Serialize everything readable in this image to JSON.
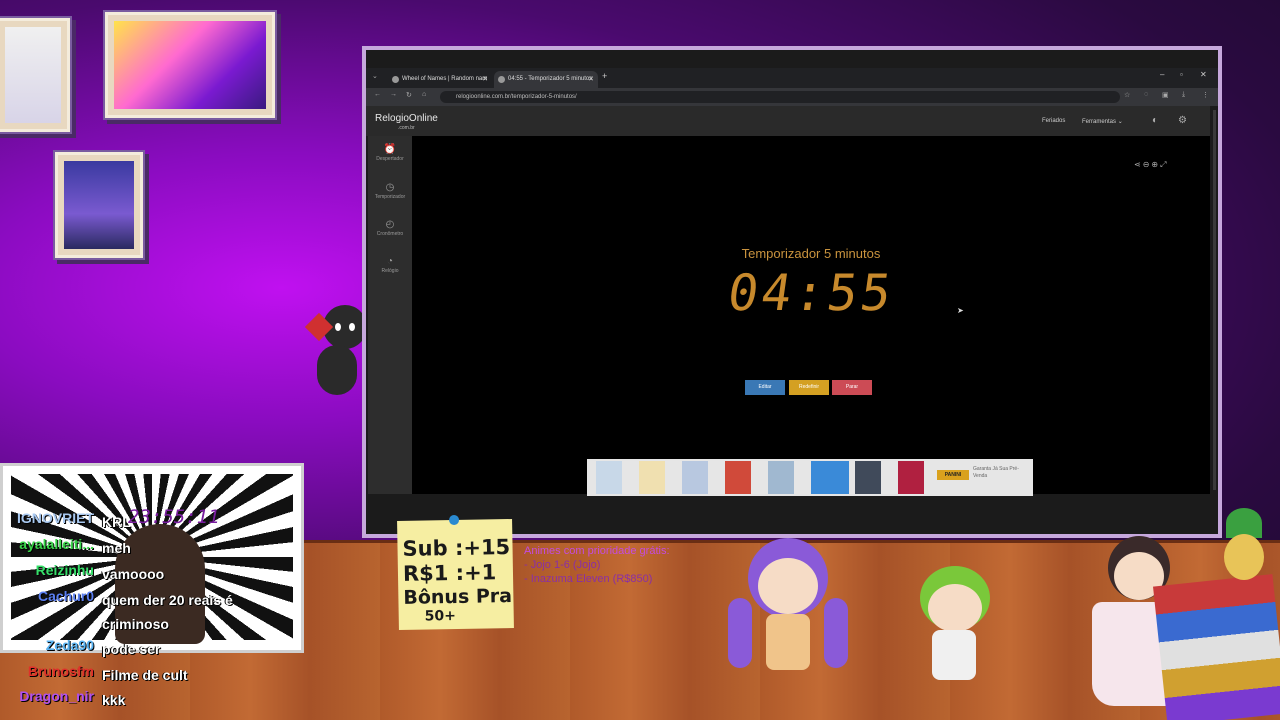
{
  "browser": {
    "tabs": [
      {
        "label": "Wheel of Names | Random nam"
      },
      {
        "label": "04:55 - Temporizador 5 minutos"
      }
    ],
    "url": "relogioonline.com.br/temporizador-5-minutos/"
  },
  "site": {
    "logo": "RelogioOnline",
    "logo_sub": ".com.br",
    "nav": [
      {
        "label": "Feriados"
      },
      {
        "label": "Ferramentas"
      }
    ],
    "sidebar": [
      {
        "label": "Despertador",
        "icon": "alarm-clock-icon"
      },
      {
        "label": "Temporizador",
        "icon": "timer-icon"
      },
      {
        "label": "Cronômetro",
        "icon": "stopwatch-icon"
      },
      {
        "label": "Relógio",
        "icon": "clock-icon"
      }
    ]
  },
  "timer": {
    "title": "Temporizador 5 minutos",
    "time": "04:55",
    "buttons": [
      {
        "label": "Editar",
        "color": "#3a78b5"
      },
      {
        "label": "Redefinir",
        "color": "#d4a022"
      },
      {
        "label": "Parar",
        "color": "#cc4b55"
      }
    ]
  },
  "ad": {
    "brand": "PANINI",
    "text": "Garanta Já Sua Pré-Venda"
  },
  "stream": {
    "cam_time": "23:55:11",
    "chat": [
      {
        "user": "IGNOVRIET",
        "color": "#a8c8f0",
        "text": "KRL"
      },
      {
        "user": "ayalalleiti...",
        "color": "#3ad64a",
        "text": "meh"
      },
      {
        "user": "Reizinhu",
        "color": "#36e06a",
        "text": "vamoooo"
      },
      {
        "user": "Cachur0",
        "color": "#5a7ef0",
        "text": "quem der 20 reais é criminoso"
      },
      {
        "user": "Zeda90",
        "color": "#5ab2f0",
        "text": "pode ser"
      },
      {
        "user": "Brunosfm",
        "color": "#e0302a",
        "text": "Filme de cult"
      },
      {
        "user": "Dragon_nir",
        "color": "#b050f0",
        "text": "kkk"
      }
    ],
    "note": [
      "Sub :+15",
      "R$1 :+1",
      "Bônus Pra",
      "50+"
    ],
    "priority_title": "Animes com prioridade grátis:",
    "priority_items": [
      "- Jojo 1-6 (Jojo)",
      "- Inazuma Eleven (R$850)"
    ]
  }
}
